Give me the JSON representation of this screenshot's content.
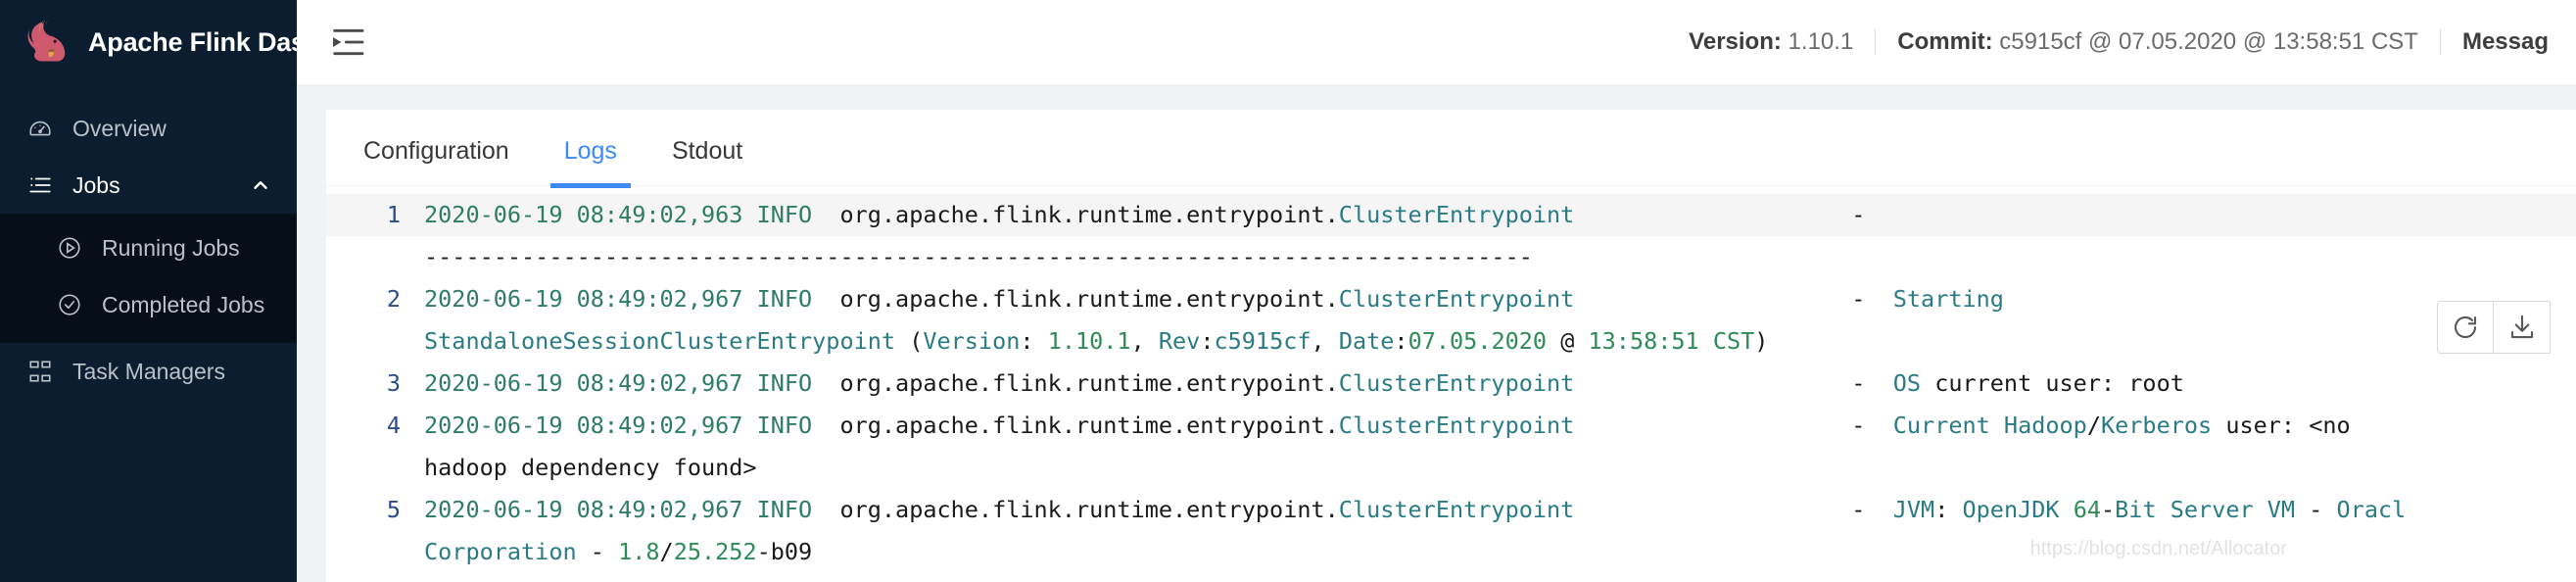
{
  "sidebar": {
    "brand": {
      "title": "Apache Flink Dashboard",
      "logo_icon": "flink-squirrel-logo"
    },
    "items": [
      {
        "label": "Overview",
        "icon": "dashboard-gauge-icon",
        "active": false,
        "expandable": false
      },
      {
        "label": "Jobs",
        "icon": "list-icon",
        "active": true,
        "expandable": true,
        "chevron": "chevron-up-icon"
      }
    ],
    "submenu": [
      {
        "label": "Running Jobs",
        "icon": "play-circle-icon"
      },
      {
        "label": "Completed Jobs",
        "icon": "check-circle-icon"
      }
    ],
    "bottom_item": {
      "label": "Task Managers",
      "icon": "cluster-icon"
    }
  },
  "topbar": {
    "collapse_icon": "menu-fold-icon",
    "version_label": "Version:",
    "version_value": "1.10.1",
    "commit_label": "Commit:",
    "commit_value": "c5915cf @ 07.05.2020 @ 13:58:51 CST",
    "message_label": "Messag"
  },
  "tabs": [
    {
      "label": "Configuration",
      "active": false
    },
    {
      "label": "Logs",
      "active": true
    },
    {
      "label": "Stdout",
      "active": false
    }
  ],
  "toolbar": {
    "refresh_icon": "reload-icon",
    "download_icon": "download-icon"
  },
  "accent_color": "#3c8bf5",
  "sidebar_color": "#0b1d2e",
  "watermark": "https://blog.csdn.net/Allocator",
  "logs": {
    "lines": [
      {
        "number": "1",
        "stripe": true,
        "tokens": [
          {
            "t": "2020-06-19 08:49:02,963 ",
            "c": "t-time"
          },
          {
            "t": "INFO",
            "c": "t-lvl"
          },
          {
            "t": "  org.apache.flink.runtime.entrypoint.",
            "c": "t-plain"
          },
          {
            "t": "ClusterEntrypoint",
            "c": "t-cls"
          },
          {
            "t": "                    -  ",
            "c": "t-plain"
          }
        ]
      },
      {
        "number": "",
        "stripe": false,
        "tokens": [
          {
            "t": "--------------------------------------------------------------------------------",
            "c": "t-plain"
          }
        ]
      },
      {
        "number": "2",
        "stripe": false,
        "tokens": [
          {
            "t": "2020-06-19 08:49:02,967 ",
            "c": "t-time"
          },
          {
            "t": "INFO",
            "c": "t-lvl"
          },
          {
            "t": "  org.apache.flink.runtime.entrypoint.",
            "c": "t-plain"
          },
          {
            "t": "ClusterEntrypoint",
            "c": "t-cls"
          },
          {
            "t": "                    -  ",
            "c": "t-plain"
          },
          {
            "t": "Starting",
            "c": "t-cls"
          }
        ]
      },
      {
        "number": "",
        "stripe": false,
        "tokens": [
          {
            "t": "StandaloneSessionClusterEntrypoint",
            "c": "t-cls"
          },
          {
            "t": " (",
            "c": "t-plain"
          },
          {
            "t": "Version",
            "c": "t-cls"
          },
          {
            "t": ": ",
            "c": "t-plain"
          },
          {
            "t": "1.10.1",
            "c": "t-num"
          },
          {
            "t": ", ",
            "c": "t-plain"
          },
          {
            "t": "Rev",
            "c": "t-cls"
          },
          {
            "t": ":",
            "c": "t-plain"
          },
          {
            "t": "c5915cf",
            "c": "t-cls"
          },
          {
            "t": ", ",
            "c": "t-plain"
          },
          {
            "t": "Date",
            "c": "t-cls"
          },
          {
            "t": ":",
            "c": "t-plain"
          },
          {
            "t": "07.05.2020",
            "c": "t-num"
          },
          {
            "t": " @ ",
            "c": "t-plain"
          },
          {
            "t": "13:58:51 CST",
            "c": "t-num"
          },
          {
            "t": ")",
            "c": "t-plain"
          }
        ]
      },
      {
        "number": "3",
        "stripe": false,
        "tokens": [
          {
            "t": "2020-06-19 08:49:02,967 ",
            "c": "t-time"
          },
          {
            "t": "INFO",
            "c": "t-lvl"
          },
          {
            "t": "  org.apache.flink.runtime.entrypoint.",
            "c": "t-plain"
          },
          {
            "t": "ClusterEntrypoint",
            "c": "t-cls"
          },
          {
            "t": "                    -  ",
            "c": "t-plain"
          },
          {
            "t": "OS",
            "c": "t-cls"
          },
          {
            "t": " current user: root",
            "c": "t-plain"
          }
        ]
      },
      {
        "number": "4",
        "stripe": false,
        "tokens": [
          {
            "t": "2020-06-19 08:49:02,967 ",
            "c": "t-time"
          },
          {
            "t": "INFO",
            "c": "t-lvl"
          },
          {
            "t": "  org.apache.flink.runtime.entrypoint.",
            "c": "t-plain"
          },
          {
            "t": "ClusterEntrypoint",
            "c": "t-cls"
          },
          {
            "t": "                    -  ",
            "c": "t-plain"
          },
          {
            "t": "Current Hadoop",
            "c": "t-cls"
          },
          {
            "t": "/",
            "c": "t-plain"
          },
          {
            "t": "Kerberos",
            "c": "t-cls"
          },
          {
            "t": " user: <no",
            "c": "t-plain"
          }
        ]
      },
      {
        "number": "",
        "stripe": false,
        "tokens": [
          {
            "t": "hadoop dependency found>",
            "c": "t-plain"
          }
        ]
      },
      {
        "number": "5",
        "stripe": false,
        "tokens": [
          {
            "t": "2020-06-19 08:49:02,967 ",
            "c": "t-time"
          },
          {
            "t": "INFO",
            "c": "t-lvl"
          },
          {
            "t": "  org.apache.flink.runtime.entrypoint.",
            "c": "t-plain"
          },
          {
            "t": "ClusterEntrypoint",
            "c": "t-cls"
          },
          {
            "t": "                    -  ",
            "c": "t-plain"
          },
          {
            "t": "JVM",
            "c": "t-cls"
          },
          {
            "t": ": ",
            "c": "t-plain"
          },
          {
            "t": "OpenJDK",
            "c": "t-cls"
          },
          {
            "t": " ",
            "c": "t-plain"
          },
          {
            "t": "64",
            "c": "t-num"
          },
          {
            "t": "-",
            "c": "t-plain"
          },
          {
            "t": "Bit Server VM",
            "c": "t-cls"
          },
          {
            "t": " - ",
            "c": "t-plain"
          },
          {
            "t": "Oracl",
            "c": "t-cls"
          }
        ]
      },
      {
        "number": "",
        "stripe": false,
        "tokens": [
          {
            "t": "Corporation",
            "c": "t-cls"
          },
          {
            "t": " - ",
            "c": "t-plain"
          },
          {
            "t": "1.8",
            "c": "t-num"
          },
          {
            "t": "/",
            "c": "t-plain"
          },
          {
            "t": "25.252",
            "c": "t-num"
          },
          {
            "t": "-b09",
            "c": "t-plain"
          }
        ]
      }
    ]
  }
}
